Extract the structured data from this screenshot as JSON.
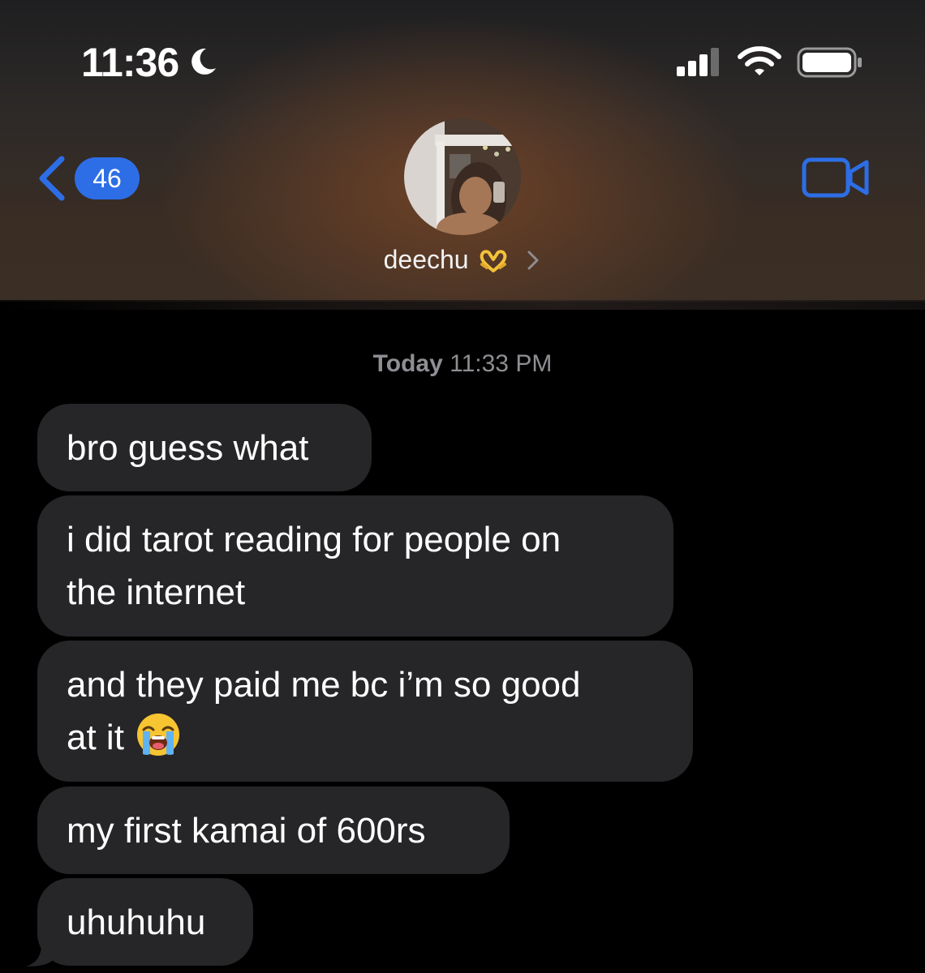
{
  "status_bar": {
    "time": "11:36",
    "focus_icon": "moon-icon",
    "signal_icon": "signal-icon",
    "wifi_icon": "wifi-icon",
    "battery_icon": "battery-icon"
  },
  "nav": {
    "back_icon": "chevron-left-icon",
    "unread_count": "46",
    "contact_name": "deechu",
    "contact_emoji": "heart-hands-icon",
    "video_icon": "video-camera-icon"
  },
  "conversation": {
    "timestamp_day": "Today",
    "timestamp_time": "11:33 PM",
    "messages": [
      {
        "text": "bro guess what"
      },
      {
        "line1": "i did tarot reading for people on",
        "line2": "the internet"
      },
      {
        "line1": "and they paid me bc i’m so good",
        "line2": "at it",
        "emoji": "loudly-crying-face"
      },
      {
        "text": "my first kamai of 600rs"
      },
      {
        "text": "uhuhuhu"
      }
    ]
  },
  "colors": {
    "accent_blue": "#2d6ee6",
    "bubble_gray": "#262628",
    "timestamp_gray": "#8e8e93",
    "background": "#000000"
  }
}
